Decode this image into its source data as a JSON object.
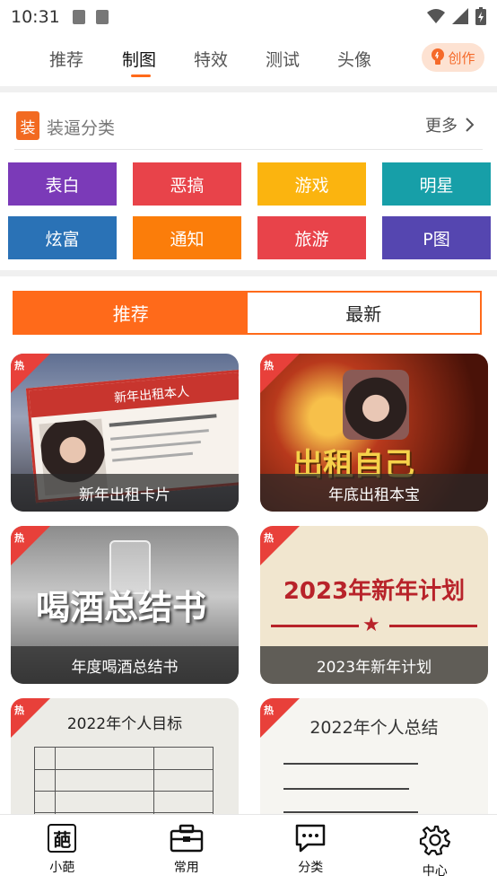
{
  "status_bar": {
    "time": "10:31"
  },
  "top_tabs": [
    {
      "label": "推荐",
      "active": false
    },
    {
      "label": "制图",
      "active": true
    },
    {
      "label": "特效",
      "active": false
    },
    {
      "label": "测试",
      "active": false
    },
    {
      "label": "头像",
      "active": false
    }
  ],
  "create_button": {
    "label": "创作"
  },
  "category_section": {
    "badge": "装",
    "title": "装逼分类",
    "more": "更多",
    "items": [
      {
        "label": "表白",
        "color": "#7b3ab8"
      },
      {
        "label": "恶搞",
        "color": "#e8434a"
      },
      {
        "label": "游戏",
        "color": "#fbb40f"
      },
      {
        "label": "明星",
        "color": "#179fa8"
      },
      {
        "label": "炫富",
        "color": "#2a72b6"
      },
      {
        "label": "通知",
        "color": "#fb7d0a"
      },
      {
        "label": "旅游",
        "color": "#e8434a"
      },
      {
        "label": "P图",
        "color": "#5546b0"
      }
    ]
  },
  "switch_tabs": {
    "recommend": "推荐",
    "latest": "最新"
  },
  "hot_tag": "热",
  "cards": [
    {
      "caption": "新年出租卡片",
      "overlay": "新年出租本人"
    },
    {
      "caption": "年底出租本宝",
      "overlay": "出租自己"
    },
    {
      "caption": "年度喝酒总结书",
      "overlay": "喝酒总结书"
    },
    {
      "caption": "2023年新年计划",
      "overlay": "2023年新年计划"
    },
    {
      "caption": "",
      "overlay": "2022年个人目标"
    },
    {
      "caption": "",
      "overlay": "2022年个人总结"
    }
  ],
  "bottom_nav": [
    {
      "label": "小葩",
      "icon": "flower-char-icon",
      "glyph": "葩"
    },
    {
      "label": "常用",
      "icon": "toolbox-icon"
    },
    {
      "label": "分类",
      "icon": "chat-bubble-icon"
    },
    {
      "label": "中心",
      "icon": "gear-icon"
    }
  ],
  "colors": {
    "accent": "#ff6a1a",
    "hot": "#e8403a"
  }
}
